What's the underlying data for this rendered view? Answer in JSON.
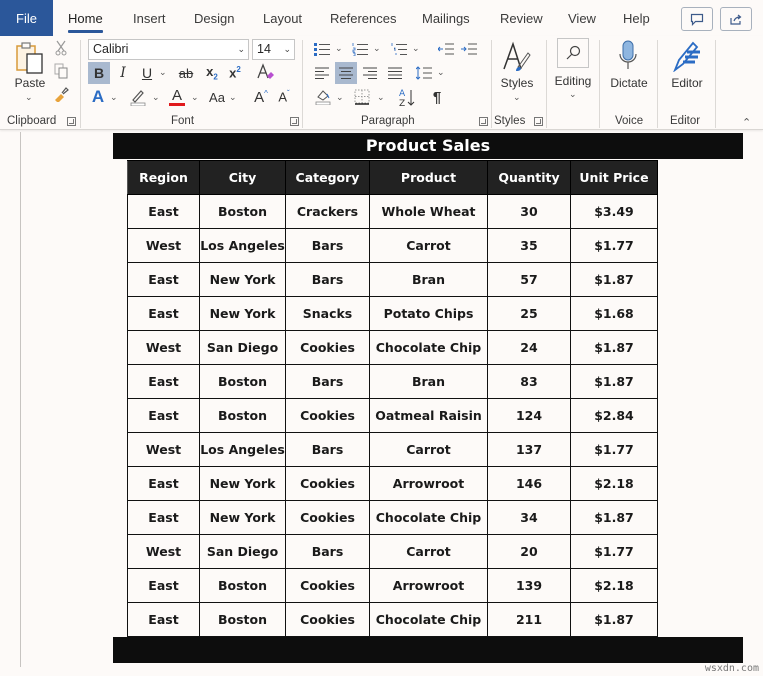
{
  "ribbon_tabs": [
    "File",
    "Home",
    "Insert",
    "Design",
    "Layout",
    "References",
    "Mailings",
    "Review",
    "View",
    "Help"
  ],
  "active_tab": "Home",
  "clipboard": {
    "paste_label": "Paste",
    "group_label": "Clipboard"
  },
  "font": {
    "name": "Calibri",
    "size": "14",
    "group_label": "Font",
    "bold_active": true,
    "font_color": "#e0191c",
    "aa_label": "Aa"
  },
  "paragraph": {
    "group_label": "Paragraph",
    "center_active": true
  },
  "styles": {
    "label": "Styles",
    "group_label": "Styles"
  },
  "editing": {
    "label": "Editing"
  },
  "voice": {
    "label": "Dictate",
    "group_label": "Voice"
  },
  "editor": {
    "label": "Editor",
    "group_label": "Editor"
  },
  "document": {
    "title": "Product Sales",
    "table": {
      "headers": [
        "Region",
        "City",
        "Category",
        "Product",
        "Quantity",
        "Unit Price"
      ],
      "rows": [
        [
          "East",
          "Boston",
          "Crackers",
          "Whole Wheat",
          "30",
          "$3.49"
        ],
        [
          "West",
          "Los Angeles",
          "Bars",
          "Carrot",
          "35",
          "$1.77"
        ],
        [
          "East",
          "New York",
          "Bars",
          "Bran",
          "57",
          "$1.87"
        ],
        [
          "East",
          "New York",
          "Snacks",
          "Potato Chips",
          "25",
          "$1.68"
        ],
        [
          "West",
          "San Diego",
          "Cookies",
          "Chocolate Chip",
          "24",
          "$1.87"
        ],
        [
          "East",
          "Boston",
          "Bars",
          "Bran",
          "83",
          "$1.87"
        ],
        [
          "East",
          "Boston",
          "Cookies",
          "Oatmeal Raisin",
          "124",
          "$2.84"
        ],
        [
          "West",
          "Los Angeles",
          "Bars",
          "Carrot",
          "137",
          "$1.77"
        ],
        [
          "East",
          "New York",
          "Cookies",
          "Arrowroot",
          "146",
          "$2.18"
        ],
        [
          "East",
          "New York",
          "Cookies",
          "Chocolate Chip",
          "34",
          "$1.87"
        ],
        [
          "West",
          "San Diego",
          "Bars",
          "Carrot",
          "20",
          "$1.77"
        ],
        [
          "East",
          "Boston",
          "Cookies",
          "Arrowroot",
          "139",
          "$2.18"
        ],
        [
          "East",
          "Boston",
          "Cookies",
          "Chocolate Chip",
          "211",
          "$1.87"
        ]
      ]
    }
  },
  "watermark": "wsxdn.com",
  "colors": {
    "file_tab": "#2b579a",
    "header_bg": "#222222",
    "title_bar_bg": "#0d0d0d",
    "selected_btn": "#a9b9cf",
    "accent_blue": "#2b6cc4"
  }
}
